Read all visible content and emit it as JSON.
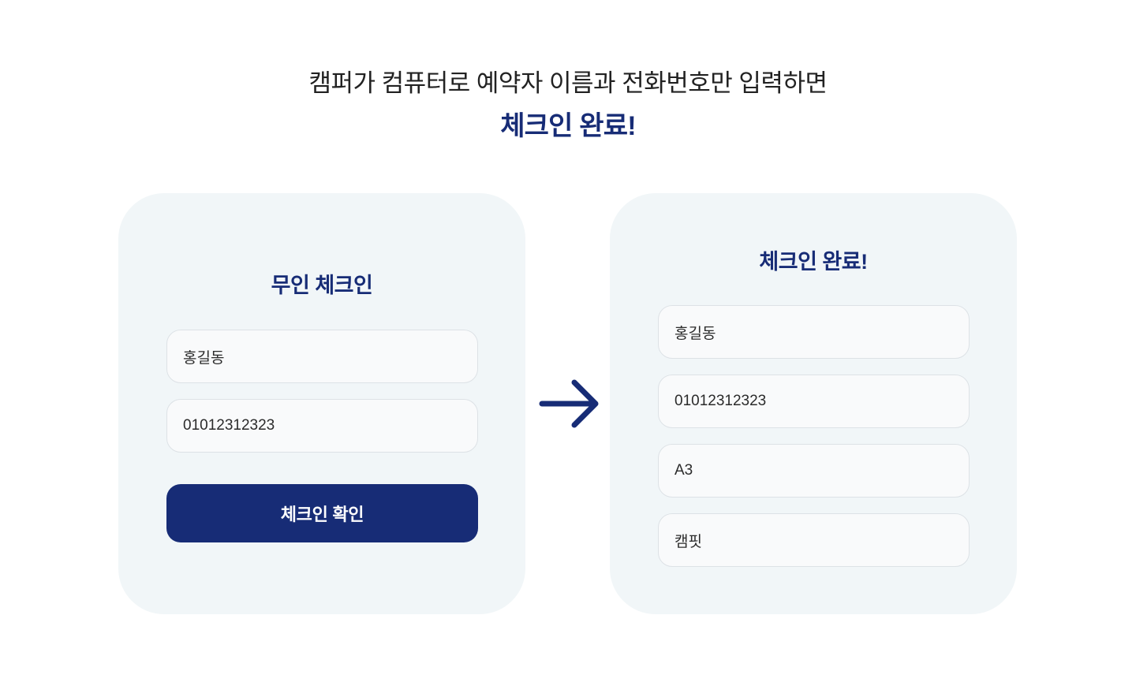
{
  "heading": {
    "line1": "캠퍼가 컴퓨터로 예약자 이름과 전화번호만 입력하면",
    "line2": "체크인 완료!"
  },
  "left_card": {
    "title": "무인 체크인",
    "name_value": "홍길동",
    "phone_value": "01012312323",
    "button_label": "체크인 확인"
  },
  "arrow": {
    "icon": "arrow-right-icon"
  },
  "right_card": {
    "title": "체크인 완료!",
    "name": "홍길동",
    "phone": "01012312323",
    "site": "A3",
    "brand": "캠핏"
  },
  "colors": {
    "brand_navy": "#172c76",
    "card_bg": "#f1f6f8",
    "field_bg": "#f9fafb",
    "field_border": "#dde2e6"
  }
}
